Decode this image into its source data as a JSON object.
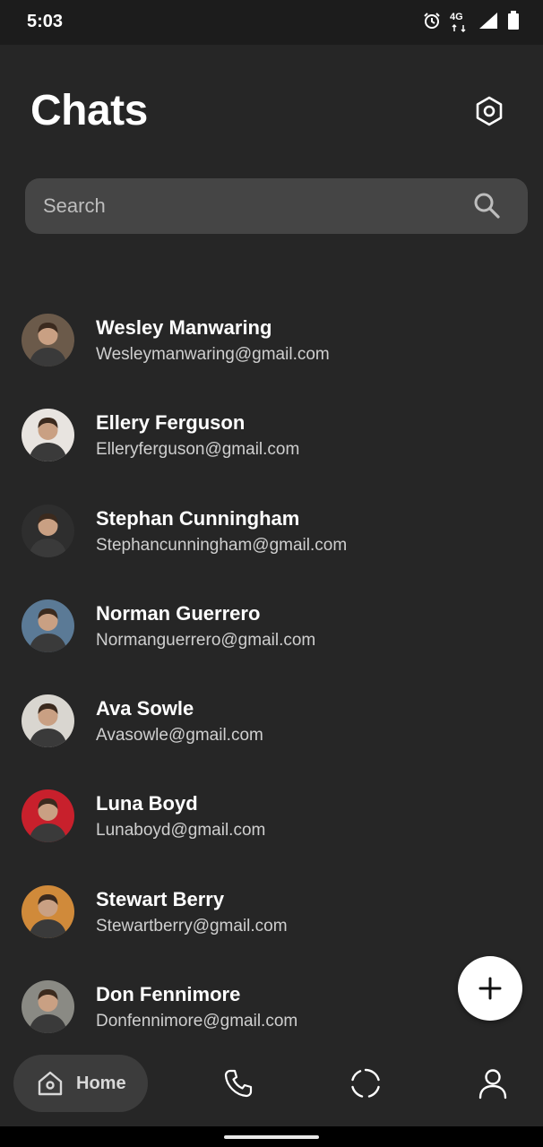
{
  "status_bar": {
    "time": "5:03",
    "network": "4G",
    "icons": [
      "alarm-icon",
      "network-4g-icon",
      "signal-icon",
      "battery-icon"
    ]
  },
  "header": {
    "title": "Chats",
    "settings_icon": "settings-hexagon-icon"
  },
  "search": {
    "placeholder": "Search",
    "value": "",
    "icon": "search-icon"
  },
  "chats": [
    {
      "name": "Wesley Manwaring",
      "email": "Wesleymanwaring@gmail.com",
      "avatar_color": "#6b5a4a"
    },
    {
      "name": "Ellery Ferguson",
      "email": "Elleryferguson@gmail.com",
      "avatar_color": "#e8e4e0"
    },
    {
      "name": "Stephan Cunningham",
      "email": "Stephancunningham@gmail.com",
      "avatar_color": "#2e2e2e"
    },
    {
      "name": "Norman Guerrero",
      "email": "Normanguerrero@gmail.com",
      "avatar_color": "#5b7a96"
    },
    {
      "name": "Ava Sowle",
      "email": "Avasowle@gmail.com",
      "avatar_color": "#d9d6d0"
    },
    {
      "name": "Luna Boyd",
      "email": "Lunaboyd@gmail.com",
      "avatar_color": "#c8202c"
    },
    {
      "name": "Stewart Berry",
      "email": "Stewartberry@gmail.com",
      "avatar_color": "#d08a3a"
    },
    {
      "name": "Don Fennimore",
      "email": "Donfennimore@gmail.com",
      "avatar_color": "#8a8a84"
    }
  ],
  "fab": {
    "icon": "plus-icon"
  },
  "bottom_nav": {
    "home_label": "Home",
    "items": [
      "home-icon",
      "phone-icon",
      "status-icon",
      "profile-icon"
    ]
  },
  "colors": {
    "background": "#262626",
    "status_bar": "#1c1c1c",
    "search_bg": "#454545",
    "nav_active_bg": "#3c3c3c",
    "fab_bg": "#ffffff"
  }
}
